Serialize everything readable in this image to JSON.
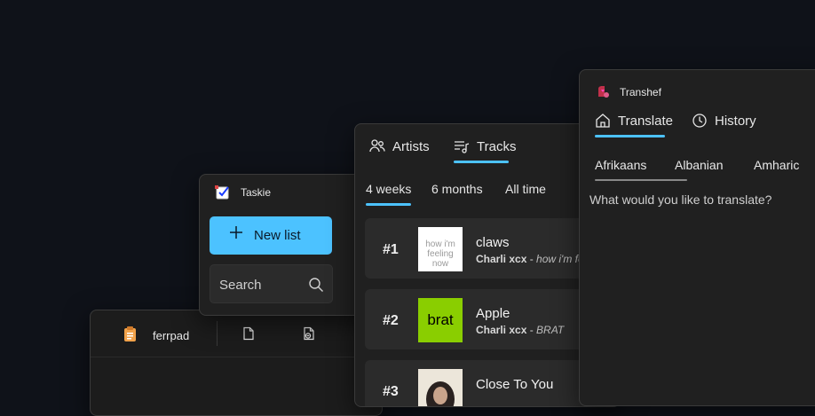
{
  "ferrpad": {
    "title": "ferrpad"
  },
  "taskie": {
    "title": "Taskie",
    "new_list_label": "New list",
    "search_placeholder": "Search"
  },
  "tracks_app": {
    "tabs": [
      {
        "label": "Artists",
        "icon": "people-icon"
      },
      {
        "label": "Tracks",
        "icon": "music-list-icon",
        "selected": true
      }
    ],
    "periods": [
      {
        "label": "4 weeks",
        "selected": true
      },
      {
        "label": "6 months"
      },
      {
        "label": "All time"
      }
    ],
    "tracks": [
      {
        "rank": "#1",
        "name": "claws",
        "artist": "Charli xcx",
        "album": "how i'm feeling now",
        "art_text": "how i'm feeling now",
        "art_bg": "#ffffff",
        "art_fg": "#9a9a9a"
      },
      {
        "rank": "#2",
        "name": "Apple",
        "artist": "Charli xcx",
        "album": "BRAT",
        "art_text": "brat",
        "art_bg": "#8ace00",
        "art_fg": "#000000"
      },
      {
        "rank": "#3",
        "name": "Close To You",
        "artist": "",
        "album": "",
        "art_text": "",
        "art_bg": "#ece6da",
        "art_fg": "#222222"
      }
    ],
    "accent": "#4cc2ff"
  },
  "transhef": {
    "title": "Transhef",
    "tabs": [
      {
        "label": "Translate",
        "icon": "home-icon",
        "selected": true
      },
      {
        "label": "History",
        "icon": "clock-icon"
      }
    ],
    "languages": [
      "Afrikaans",
      "Albanian",
      "Amharic"
    ],
    "prompt": "What would you like to translate?"
  }
}
